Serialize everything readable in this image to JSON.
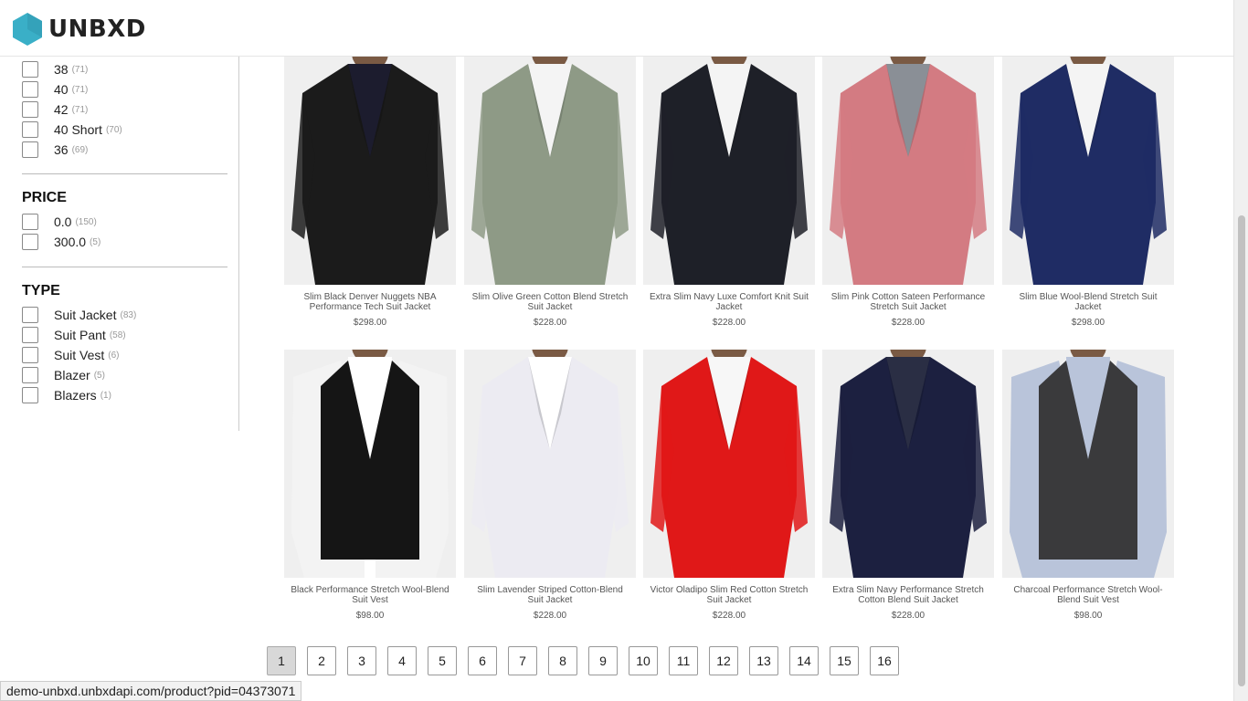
{
  "brand": {
    "name": "UNBXD",
    "accent": "#3aafc7"
  },
  "size_facet": {
    "items": [
      {
        "label": "38",
        "count": "(71)"
      },
      {
        "label": "40",
        "count": "(71)"
      },
      {
        "label": "42",
        "count": "(71)"
      },
      {
        "label": "40 Short",
        "count": "(70)"
      },
      {
        "label": "36",
        "count": "(69)"
      }
    ]
  },
  "price_facet": {
    "title": "PRICE",
    "items": [
      {
        "label": "0.0",
        "count": "(150)"
      },
      {
        "label": "300.0",
        "count": "(5)"
      }
    ]
  },
  "type_facet": {
    "title": "TYPE",
    "items": [
      {
        "label": "Suit Jacket",
        "count": "(83)"
      },
      {
        "label": "Suit Pant",
        "count": "(58)"
      },
      {
        "label": "Suit Vest",
        "count": "(6)"
      },
      {
        "label": "Blazer",
        "count": "(5)"
      },
      {
        "label": "Blazers",
        "count": "(1)"
      }
    ]
  },
  "products": [
    {
      "name": "Slim Black Denver Nuggets NBA Performance Tech Suit Jacket",
      "price": "$298.00",
      "color": "#1b1b1b",
      "shirt": "#1c1c2e"
    },
    {
      "name": "Slim Olive Green Cotton Blend Stretch Suit Jacket",
      "price": "$228.00",
      "color": "#8e9a86",
      "shirt": "#f4f4f4"
    },
    {
      "name": "Extra Slim Navy Luxe Comfort Knit Suit Jacket",
      "price": "$228.00",
      "color": "#1e2028",
      "shirt": "#f4f4f4"
    },
    {
      "name": "Slim Pink Cotton Sateen Performance Stretch Suit Jacket",
      "price": "$228.00",
      "color": "#d37b82",
      "shirt": "#8a8f96"
    },
    {
      "name": "Slim Blue Wool-Blend Stretch Suit Jacket",
      "price": "$298.00",
      "color": "#1f2c64",
      "shirt": "#f4f4f4"
    },
    {
      "name": "Black Performance Stretch Wool-Blend Suit Vest",
      "price": "$98.00",
      "color": "#151515",
      "shirt": "#ffffff"
    },
    {
      "name": "Slim Lavender Striped Cotton-Blend Suit Jacket",
      "price": "$228.00",
      "color": "#ecebf2",
      "shirt": "#ffffff"
    },
    {
      "name": "Victor Oladipo Slim Red Cotton Stretch Suit Jacket",
      "price": "$228.00",
      "color": "#e01818",
      "shirt": "#f7f7f7"
    },
    {
      "name": "Extra Slim Navy Performance Stretch Cotton Blend Suit Jacket",
      "price": "$228.00",
      "color": "#1c2040",
      "shirt": "#2a2e44"
    },
    {
      "name": "Charcoal Performance Stretch Wool-Blend Suit Vest",
      "price": "$98.00",
      "color": "#3a3a3c",
      "shirt": "#b9c4da"
    }
  ],
  "pagination": {
    "pages": [
      "1",
      "2",
      "3",
      "4",
      "5",
      "6",
      "7",
      "8",
      "9",
      "10",
      "11",
      "12",
      "13",
      "14",
      "15",
      "16"
    ],
    "current": "1"
  },
  "status_bar": {
    "url": "demo-unbxd.unbxdapi.com/product?pid=04373071"
  }
}
